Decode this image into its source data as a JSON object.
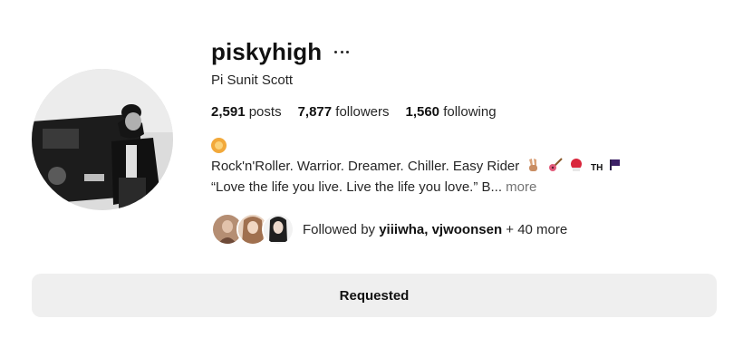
{
  "profile": {
    "username": "piskyhigh",
    "full_name": "Pi Sunit Scott",
    "stats": {
      "posts_count": "2,591",
      "posts_label": "posts",
      "followers_count": "7,877",
      "followers_label": "followers",
      "following_count": "1,560",
      "following_label": "following"
    },
    "bio": {
      "line1_emoji": "lion-face-emoji",
      "line2": "Rock'n'Roller. Warrior. Dreamer. Chiller. Easy Rider",
      "line2_emojis": [
        "victory-hand-emoji",
        "guitar-emoji",
        "boxing-glove-emoji"
      ],
      "line2_suffix": "TH",
      "line3": "“Love the life you live. Live the life you love.” B...",
      "more_label": "more"
    },
    "followed_by": {
      "prefix": "Followed by ",
      "user1": "yiiiwha",
      "separator": ", ",
      "user2": "vjwoonsen",
      "suffix": " + 40 more"
    }
  },
  "actions": {
    "requested_label": "Requested"
  },
  "colors": {
    "button_bg": "#efefef",
    "muted_text": "#737373",
    "primary_text": "#262626"
  }
}
